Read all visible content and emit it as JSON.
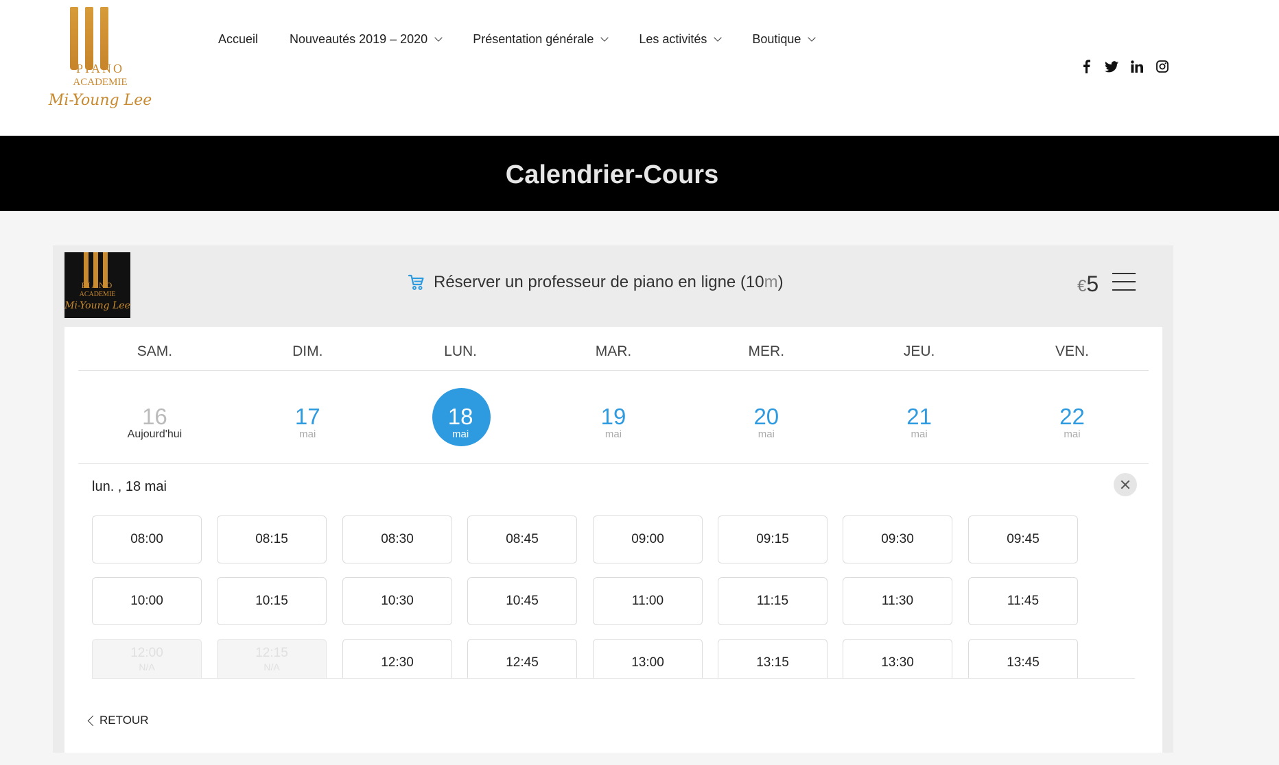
{
  "logo": {
    "line1": "PIANO",
    "line2": "ACADEMIE",
    "signature": "Mi-Young Lee"
  },
  "nav": [
    {
      "label": "Accueil",
      "dropdown": false
    },
    {
      "label": "Nouveautés 2019 – 2020",
      "dropdown": true
    },
    {
      "label": "Présentation générale",
      "dropdown": true
    },
    {
      "label": "Les activités",
      "dropdown": true
    },
    {
      "label": "Boutique",
      "dropdown": true
    }
  ],
  "social": [
    "facebook-icon",
    "twitter-icon",
    "linkedin-icon",
    "instagram-icon"
  ],
  "page_title": "Calendrier-Cours",
  "booking": {
    "service": "Réserver un professeur de piano en ligne (10",
    "service_unit": "m",
    "service_close": ")",
    "currency": "€",
    "price": "5",
    "weekdays": [
      "SAM.",
      "DIM.",
      "LUN.",
      "MAR.",
      "MER.",
      "JEU.",
      "VEN."
    ],
    "days": [
      {
        "num": "16",
        "label": "Aujourd'hui",
        "state": "today"
      },
      {
        "num": "17",
        "label": "mai",
        "state": "available"
      },
      {
        "num": "18",
        "label": "mai",
        "state": "selected"
      },
      {
        "num": "19",
        "label": "mai",
        "state": "available"
      },
      {
        "num": "20",
        "label": "mai",
        "state": "available"
      },
      {
        "num": "21",
        "label": "mai",
        "state": "available"
      },
      {
        "num": "22",
        "label": "mai",
        "state": "available"
      }
    ],
    "selected_date": "lun. , 18 mai",
    "slots": [
      {
        "time": "08:00",
        "available": true
      },
      {
        "time": "08:15",
        "available": true
      },
      {
        "time": "08:30",
        "available": true
      },
      {
        "time": "08:45",
        "available": true
      },
      {
        "time": "09:00",
        "available": true
      },
      {
        "time": "09:15",
        "available": true
      },
      {
        "time": "09:30",
        "available": true
      },
      {
        "time": "09:45",
        "available": true
      },
      {
        "time": "10:00",
        "available": true
      },
      {
        "time": "10:15",
        "available": true
      },
      {
        "time": "10:30",
        "available": true
      },
      {
        "time": "10:45",
        "available": true
      },
      {
        "time": "11:00",
        "available": true
      },
      {
        "time": "11:15",
        "available": true
      },
      {
        "time": "11:30",
        "available": true
      },
      {
        "time": "11:45",
        "available": true
      },
      {
        "time": "12:00",
        "available": false,
        "note": "N/A"
      },
      {
        "time": "12:15",
        "available": false,
        "note": "N/A"
      },
      {
        "time": "12:30",
        "available": true
      },
      {
        "time": "12:45",
        "available": true
      },
      {
        "time": "13:00",
        "available": true
      },
      {
        "time": "13:15",
        "available": true
      },
      {
        "time": "13:30",
        "available": true
      },
      {
        "time": "13:45",
        "available": true
      }
    ],
    "back_label": "RETOUR",
    "accent_color": "#2e9be0"
  }
}
